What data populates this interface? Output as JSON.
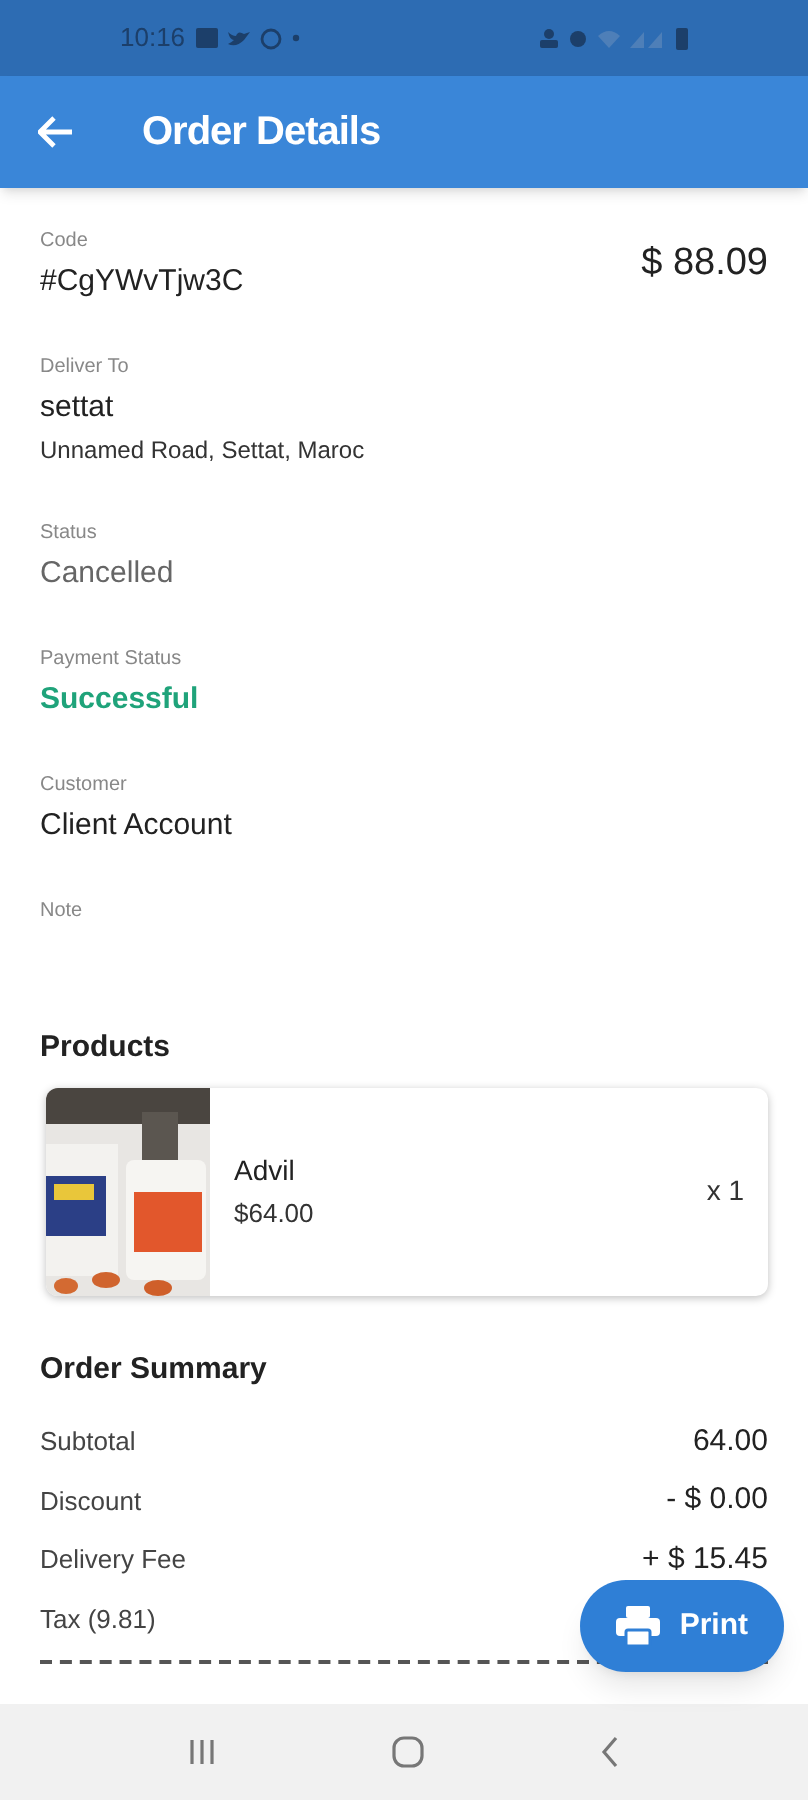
{
  "status_bar": {
    "time": "10:16"
  },
  "app_bar": {
    "title": "Order Details"
  },
  "order": {
    "total": "$ 88.09"
  },
  "fields": [
    {
      "label": "Code",
      "value": "#CgYWvTjw3C",
      "kind": "plain"
    },
    {
      "label": "Deliver To",
      "value": "settat",
      "detail": "Unnamed Road, Settat, Maroc",
      "kind": "plain"
    },
    {
      "label": "Status",
      "value": "Cancelled",
      "kind": "muted"
    },
    {
      "label": "Payment Status",
      "value": "Successful",
      "kind": "success"
    },
    {
      "label": "Customer",
      "value": "Client Account",
      "kind": "plain"
    },
    {
      "label": "Note"
    }
  ],
  "products": {
    "title": "Products",
    "items": [
      {
        "kind": "picture",
        "name": "Advil",
        "price": "$64.00",
        "quantity": "x 1"
      }
    ]
  },
  "summary": {
    "title": "Order Summary",
    "rows": [
      {
        "label": "Subtotal",
        "value": "64.00"
      },
      {
        "label": "Discount",
        "value": "- $ 0.00"
      },
      {
        "label": "Delivery Fee",
        "value": "+ $ 15.45"
      },
      {
        "label": "Tax (9.81)"
      }
    ]
  },
  "fab": {
    "label": "Print"
  }
}
